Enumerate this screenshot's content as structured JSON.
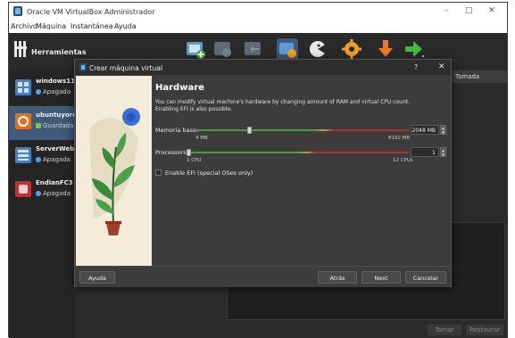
{
  "window": {
    "title": "Oracle VM VirtualBox Administrador",
    "controls": {
      "minimize": "–",
      "maximize": "□",
      "close": "✕"
    }
  },
  "menu": [
    "Archivo",
    "Máquina",
    "Instantánea",
    "Ayuda"
  ],
  "toolbar": {
    "tools_label": "Herramientas",
    "icons": [
      "new-icon",
      "settings-icon",
      "discard-icon",
      "show-icon",
      "import-icon",
      "preferences-icon",
      "download-icon",
      "start-arrow-icon"
    ]
  },
  "vms": [
    {
      "name": "windows11",
      "state": "Apagada",
      "badge": "11"
    },
    {
      "name": "ubuntuyoru",
      "state": "Guardada"
    },
    {
      "name": "ServerWeb",
      "state": "Apagada"
    },
    {
      "name": "EndianFC3",
      "state": "Apagada"
    }
  ],
  "snapshots": {
    "header": "Tomada"
  },
  "bottom_buttons": [
    "Tomar",
    "Restaurar"
  ],
  "dialog": {
    "title": "Crear máquina virtual",
    "help_glyph": "?",
    "close_glyph": "✕",
    "heading": "Hardware",
    "description": "You can modify virtual machine's hardware by changing amount of RAM and virtual CPU count. Enabling EFI is also possible.",
    "memory": {
      "label": "Memoria base:",
      "value": 2048,
      "value_text": "2048 MB",
      "min_label": "4 MB",
      "max_label": "8192 MB",
      "min": 4,
      "max": 8192
    },
    "processors": {
      "label": "Processors:",
      "value": 1,
      "value_text": "1",
      "min_label": "1 CPU",
      "max_label": "12 CPUs",
      "min": 1,
      "max": 12
    },
    "efi_label": "Enable EFI (special OSes only)",
    "efi_checked": false,
    "buttons": {
      "help": "Ayuda",
      "back": "Atrás",
      "next": "Next",
      "cancel": "Cancelar"
    }
  },
  "colors": {
    "accent": "#3f5a7a",
    "slider_green": "#4a9a3a",
    "slider_red": "#b03030",
    "orange": "#f0a020"
  }
}
